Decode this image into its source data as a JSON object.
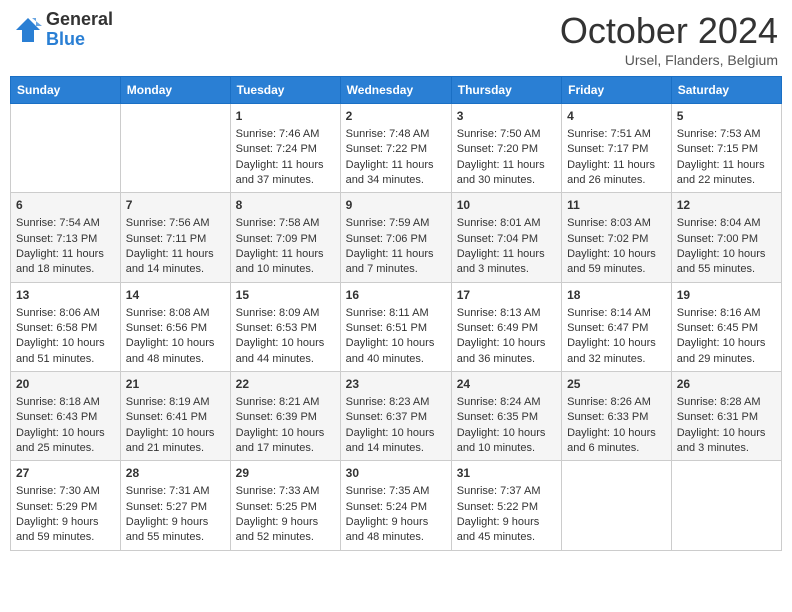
{
  "header": {
    "logo_general": "General",
    "logo_blue": "Blue",
    "month_title": "October 2024",
    "location": "Ursel, Flanders, Belgium"
  },
  "weekdays": [
    "Sunday",
    "Monday",
    "Tuesday",
    "Wednesday",
    "Thursday",
    "Friday",
    "Saturday"
  ],
  "weeks": [
    [
      {
        "day": "",
        "sunrise": "",
        "sunset": "",
        "daylight": ""
      },
      {
        "day": "",
        "sunrise": "",
        "sunset": "",
        "daylight": ""
      },
      {
        "day": "1",
        "sunrise": "Sunrise: 7:46 AM",
        "sunset": "Sunset: 7:24 PM",
        "daylight": "Daylight: 11 hours and 37 minutes."
      },
      {
        "day": "2",
        "sunrise": "Sunrise: 7:48 AM",
        "sunset": "Sunset: 7:22 PM",
        "daylight": "Daylight: 11 hours and 34 minutes."
      },
      {
        "day": "3",
        "sunrise": "Sunrise: 7:50 AM",
        "sunset": "Sunset: 7:20 PM",
        "daylight": "Daylight: 11 hours and 30 minutes."
      },
      {
        "day": "4",
        "sunrise": "Sunrise: 7:51 AM",
        "sunset": "Sunset: 7:17 PM",
        "daylight": "Daylight: 11 hours and 26 minutes."
      },
      {
        "day": "5",
        "sunrise": "Sunrise: 7:53 AM",
        "sunset": "Sunset: 7:15 PM",
        "daylight": "Daylight: 11 hours and 22 minutes."
      }
    ],
    [
      {
        "day": "6",
        "sunrise": "Sunrise: 7:54 AM",
        "sunset": "Sunset: 7:13 PM",
        "daylight": "Daylight: 11 hours and 18 minutes."
      },
      {
        "day": "7",
        "sunrise": "Sunrise: 7:56 AM",
        "sunset": "Sunset: 7:11 PM",
        "daylight": "Daylight: 11 hours and 14 minutes."
      },
      {
        "day": "8",
        "sunrise": "Sunrise: 7:58 AM",
        "sunset": "Sunset: 7:09 PM",
        "daylight": "Daylight: 11 hours and 10 minutes."
      },
      {
        "day": "9",
        "sunrise": "Sunrise: 7:59 AM",
        "sunset": "Sunset: 7:06 PM",
        "daylight": "Daylight: 11 hours and 7 minutes."
      },
      {
        "day": "10",
        "sunrise": "Sunrise: 8:01 AM",
        "sunset": "Sunset: 7:04 PM",
        "daylight": "Daylight: 11 hours and 3 minutes."
      },
      {
        "day": "11",
        "sunrise": "Sunrise: 8:03 AM",
        "sunset": "Sunset: 7:02 PM",
        "daylight": "Daylight: 10 hours and 59 minutes."
      },
      {
        "day": "12",
        "sunrise": "Sunrise: 8:04 AM",
        "sunset": "Sunset: 7:00 PM",
        "daylight": "Daylight: 10 hours and 55 minutes."
      }
    ],
    [
      {
        "day": "13",
        "sunrise": "Sunrise: 8:06 AM",
        "sunset": "Sunset: 6:58 PM",
        "daylight": "Daylight: 10 hours and 51 minutes."
      },
      {
        "day": "14",
        "sunrise": "Sunrise: 8:08 AM",
        "sunset": "Sunset: 6:56 PM",
        "daylight": "Daylight: 10 hours and 48 minutes."
      },
      {
        "day": "15",
        "sunrise": "Sunrise: 8:09 AM",
        "sunset": "Sunset: 6:53 PM",
        "daylight": "Daylight: 10 hours and 44 minutes."
      },
      {
        "day": "16",
        "sunrise": "Sunrise: 8:11 AM",
        "sunset": "Sunset: 6:51 PM",
        "daylight": "Daylight: 10 hours and 40 minutes."
      },
      {
        "day": "17",
        "sunrise": "Sunrise: 8:13 AM",
        "sunset": "Sunset: 6:49 PM",
        "daylight": "Daylight: 10 hours and 36 minutes."
      },
      {
        "day": "18",
        "sunrise": "Sunrise: 8:14 AM",
        "sunset": "Sunset: 6:47 PM",
        "daylight": "Daylight: 10 hours and 32 minutes."
      },
      {
        "day": "19",
        "sunrise": "Sunrise: 8:16 AM",
        "sunset": "Sunset: 6:45 PM",
        "daylight": "Daylight: 10 hours and 29 minutes."
      }
    ],
    [
      {
        "day": "20",
        "sunrise": "Sunrise: 8:18 AM",
        "sunset": "Sunset: 6:43 PM",
        "daylight": "Daylight: 10 hours and 25 minutes."
      },
      {
        "day": "21",
        "sunrise": "Sunrise: 8:19 AM",
        "sunset": "Sunset: 6:41 PM",
        "daylight": "Daylight: 10 hours and 21 minutes."
      },
      {
        "day": "22",
        "sunrise": "Sunrise: 8:21 AM",
        "sunset": "Sunset: 6:39 PM",
        "daylight": "Daylight: 10 hours and 17 minutes."
      },
      {
        "day": "23",
        "sunrise": "Sunrise: 8:23 AM",
        "sunset": "Sunset: 6:37 PM",
        "daylight": "Daylight: 10 hours and 14 minutes."
      },
      {
        "day": "24",
        "sunrise": "Sunrise: 8:24 AM",
        "sunset": "Sunset: 6:35 PM",
        "daylight": "Daylight: 10 hours and 10 minutes."
      },
      {
        "day": "25",
        "sunrise": "Sunrise: 8:26 AM",
        "sunset": "Sunset: 6:33 PM",
        "daylight": "Daylight: 10 hours and 6 minutes."
      },
      {
        "day": "26",
        "sunrise": "Sunrise: 8:28 AM",
        "sunset": "Sunset: 6:31 PM",
        "daylight": "Daylight: 10 hours and 3 minutes."
      }
    ],
    [
      {
        "day": "27",
        "sunrise": "Sunrise: 7:30 AM",
        "sunset": "Sunset: 5:29 PM",
        "daylight": "Daylight: 9 hours and 59 minutes."
      },
      {
        "day": "28",
        "sunrise": "Sunrise: 7:31 AM",
        "sunset": "Sunset: 5:27 PM",
        "daylight": "Daylight: 9 hours and 55 minutes."
      },
      {
        "day": "29",
        "sunrise": "Sunrise: 7:33 AM",
        "sunset": "Sunset: 5:25 PM",
        "daylight": "Daylight: 9 hours and 52 minutes."
      },
      {
        "day": "30",
        "sunrise": "Sunrise: 7:35 AM",
        "sunset": "Sunset: 5:24 PM",
        "daylight": "Daylight: 9 hours and 48 minutes."
      },
      {
        "day": "31",
        "sunrise": "Sunrise: 7:37 AM",
        "sunset": "Sunset: 5:22 PM",
        "daylight": "Daylight: 9 hours and 45 minutes."
      },
      {
        "day": "",
        "sunrise": "",
        "sunset": "",
        "daylight": ""
      },
      {
        "day": "",
        "sunrise": "",
        "sunset": "",
        "daylight": ""
      }
    ]
  ]
}
